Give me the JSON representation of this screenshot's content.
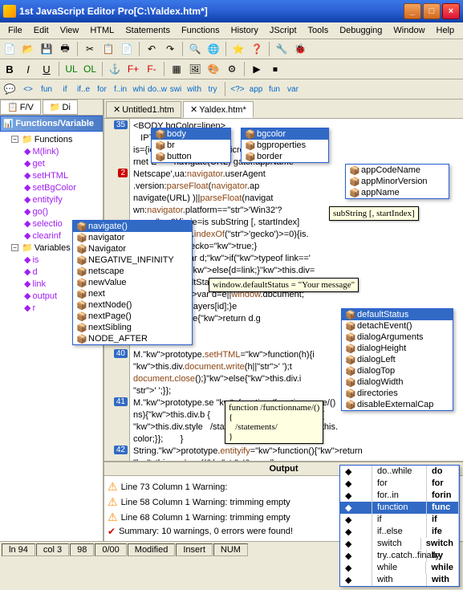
{
  "title": "1st JavaScript Editor Pro[C:\\Yaldex.htm*]",
  "menu": [
    "File",
    "Edit",
    "View",
    "HTML",
    "Statements",
    "Functions",
    "History",
    "JScript",
    "Tools",
    "Debugging",
    "Window",
    "Help"
  ],
  "fmt_buttons": {
    "bold": "B",
    "italic": "I",
    "underline": "U",
    "ul": "UL",
    "ol": "OL"
  },
  "stmt_buttons": [
    "fun",
    "if",
    "if..e",
    "for",
    "f..in",
    "whi",
    "do..w",
    "swi",
    "with",
    "try"
  ],
  "panel_tabs": [
    "F/V",
    "Di"
  ],
  "tree_header": "Functions/Variable",
  "tree": {
    "functions": {
      "label": "Functions",
      "items": [
        "M(link)",
        "get",
        "setHTML",
        "setBgColor",
        "entityify",
        "go()",
        "selectio",
        "clearinf"
      ]
    },
    "variables": {
      "label": "Variables",
      "items": [
        "is",
        "d",
        "link",
        "output",
        "r"
      ]
    }
  },
  "editor_tabs": [
    {
      "label": "Untitled1.htm",
      "active": false
    },
    {
      "label": "Yaldex.htm*",
      "active": true
    }
  ],
  "gutter_lines": [
    "35",
    "",
    "",
    "",
    "2",
    "",
    "",
    "",
    "",
    "",
    "",
    "",
    "",
    "",
    "",
    "",
    "",
    "",
    "",
    "40",
    "",
    "",
    "",
    "41",
    "",
    "",
    "",
    "42",
    ""
  ],
  "code_lines": [
    "<BODY bgColor=linen>",
    "   IPT>",
    "is={ie:                    e=='Microsoft",
    "rnet E       navigate(URL) gator.appName=='",
    "Netscape',ua:navigator.userAgent",
    ".version:parseFloat(navigator.ap",
    "navigate(URL) )||parseFloat(navigat",
    "wn:navigator.platform=='Win32'?",
    "opera')>=0){is.ie=is subString [, startIndex]",
    "e;}if(is.ua.indexOf('gecko')>=0){is.",
    "false;is.gecko=true;}",
    "M(link){var d;if(typeof link=='",
    "d=M.get(link);}else{d=link;}this.div=",
    "  window.defaultStatus = \"Your message\"",
    "ction(id,e){var d=e||window.dbcument;",
    "{return d.layers[id];}e",
    "all[id];}else{return d.g",
    "}",
    "",
    "M.prototype.setHTML=function(h){i",
    "this.div.document.write(h||' ');t",
    "document.close();}else{this.div.i",
    "' ';}};",
    "M.prototype.se function /functionname/()",
    "ns){this.div.b {                is.color;}else{",
    "this.div.style   /statements/     =color||this.",
    "color;}};       }",
    "String.prototype.entityify=function(){return",
    "this.replace(/&/g,'&amp;').r"
  ],
  "popup1": {
    "items": [
      "body",
      "br",
      "button"
    ],
    "selected": 0
  },
  "popup2": {
    "items": [
      "bgcolor",
      "bgproperties",
      "border"
    ],
    "selected": 0
  },
  "popup3": {
    "items": [
      "appCodeName",
      "appMinorVersion",
      "appName"
    ],
    "selected": -1
  },
  "popup4": {
    "items": [
      "navigate()",
      "navigator",
      "Navigator",
      "NEGATIVE_INFINITY",
      "netscape",
      "newValue",
      "next",
      "nextNode()",
      "nextPage()",
      "nextSibling",
      "NODE_AFTER"
    ],
    "selected": 0
  },
  "popup5": {
    "items": [
      "defaultStatus",
      "detachEvent()",
      "dialogArguments",
      "dialogHeight",
      "dialogLeft",
      "dialogTop",
      "dialogWidth",
      "directories",
      "disableExternalCap"
    ],
    "selected": 0
  },
  "tooltip_substring": "subString [, startIndex]",
  "tooltip_status": "window.defaultStatus = \"Your message\"",
  "tooltip_func": "function /functionname/()\n{\n   /statements/\n}",
  "output": {
    "header": "Output",
    "lines": [
      "Line 73 Column 1  Warning: <script> inserting \"typ",
      "Line 58 Column 1  Warning: trimming empty <p>",
      "Line 68 Column 1  Warning: trimming empty <p>",
      "Summary: 10 warnings, 0 errors were found!"
    ]
  },
  "snippets": {
    "rows": [
      [
        "do..while",
        "do"
      ],
      [
        "for",
        "for"
      ],
      [
        "for..in",
        "forin"
      ],
      [
        "function",
        "func"
      ],
      [
        "if",
        "if"
      ],
      [
        "if..else",
        "ife"
      ],
      [
        "switch",
        "switch"
      ],
      [
        "try..catch..finally",
        "try"
      ],
      [
        "while",
        "while"
      ],
      [
        "with",
        "with"
      ]
    ],
    "selected": 3
  },
  "status": {
    "ln": "ln 94",
    "col": "col 3",
    "pos": "98",
    "pct": "0/00",
    "mod": "Modified",
    "ins": "Insert",
    "num": "NUM"
  }
}
